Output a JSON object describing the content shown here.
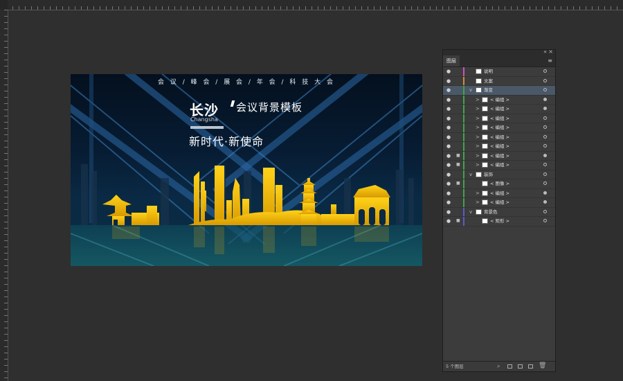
{
  "artboard": {
    "nav": "会 议 / 峰 会 / 展 会 / 年 会 / 科 技 大 会",
    "title_city": "长沙",
    "title_text": "会议背景模板",
    "title_en": "Changsha",
    "slogan": "新时代·新使命"
  },
  "layers_panel": {
    "tab": "图层",
    "count_label": "5 个图层",
    "layers": [
      {
        "name": "说明",
        "color": "#d050c0",
        "level": 0,
        "expander": "",
        "eye": true,
        "lock": false,
        "selected": false,
        "target": "empty"
      },
      {
        "name": "文案",
        "color": "#d68a3a",
        "level": 0,
        "expander": "",
        "eye": true,
        "lock": false,
        "selected": false,
        "target": "empty"
      },
      {
        "name": "渐变",
        "color": "#3fa64a",
        "level": 0,
        "expander": "v",
        "eye": true,
        "lock": false,
        "selected": true,
        "target": "empty"
      },
      {
        "name": "< 编组 >",
        "color": "#3fa64a",
        "level": 1,
        "expander": ">",
        "eye": true,
        "lock": false,
        "selected": false,
        "target": "filled"
      },
      {
        "name": "< 编组 >",
        "color": "#3fa64a",
        "level": 1,
        "expander": ">",
        "eye": true,
        "lock": false,
        "selected": false,
        "target": "filled"
      },
      {
        "name": "< 编组 >",
        "color": "#3fa64a",
        "level": 1,
        "expander": ">",
        "eye": true,
        "lock": false,
        "selected": false,
        "target": "empty"
      },
      {
        "name": "< 编组 >",
        "color": "#3fa64a",
        "level": 1,
        "expander": ">",
        "eye": true,
        "lock": false,
        "selected": false,
        "target": "empty"
      },
      {
        "name": "< 编组 >",
        "color": "#3fa64a",
        "level": 1,
        "expander": ">",
        "eye": true,
        "lock": false,
        "selected": false,
        "target": "empty"
      },
      {
        "name": "< 编组 >",
        "color": "#3fa64a",
        "level": 1,
        "expander": ">",
        "eye": true,
        "lock": false,
        "selected": false,
        "target": "empty"
      },
      {
        "name": "< 编组 >",
        "color": "#3fa64a",
        "level": 1,
        "expander": ">",
        "eye": true,
        "lock": true,
        "selected": false,
        "target": "filled"
      },
      {
        "name": "< 编组 >",
        "color": "#3fa64a",
        "level": 1,
        "expander": ">",
        "eye": true,
        "lock": true,
        "selected": false,
        "target": "empty"
      },
      {
        "name": "装饰",
        "color": "#3fa64a",
        "level": 0,
        "expander": "v",
        "eye": true,
        "lock": false,
        "selected": false,
        "target": "empty"
      },
      {
        "name": "< 图像 >",
        "color": "#3fa64a",
        "level": 1,
        "expander": "",
        "eye": true,
        "lock": true,
        "selected": false,
        "target": "empty"
      },
      {
        "name": "< 编组 >",
        "color": "#3fa64a",
        "level": 1,
        "expander": ">",
        "eye": true,
        "lock": false,
        "selected": false,
        "target": "filled"
      },
      {
        "name": "< 编组 >",
        "color": "#3fa64a",
        "level": 1,
        "expander": ">",
        "eye": true,
        "lock": false,
        "selected": false,
        "target": "filled"
      },
      {
        "name": "背景色",
        "color": "#5a5ad0",
        "level": 0,
        "expander": "v",
        "eye": true,
        "lock": false,
        "selected": false,
        "target": "empty"
      },
      {
        "name": "< 矩形 >",
        "color": "#5a5ad0",
        "level": 1,
        "expander": "",
        "eye": true,
        "lock": true,
        "selected": false,
        "target": "empty"
      }
    ]
  },
  "icons": {
    "eye": "eye-icon",
    "lock": "lock-icon",
    "expander": "chevron-icon",
    "target": "target-circle-icon",
    "footer": [
      "search-icon",
      "clipping-mask-icon",
      "new-sublayer-icon",
      "new-layer-icon",
      "trash-icon"
    ]
  }
}
